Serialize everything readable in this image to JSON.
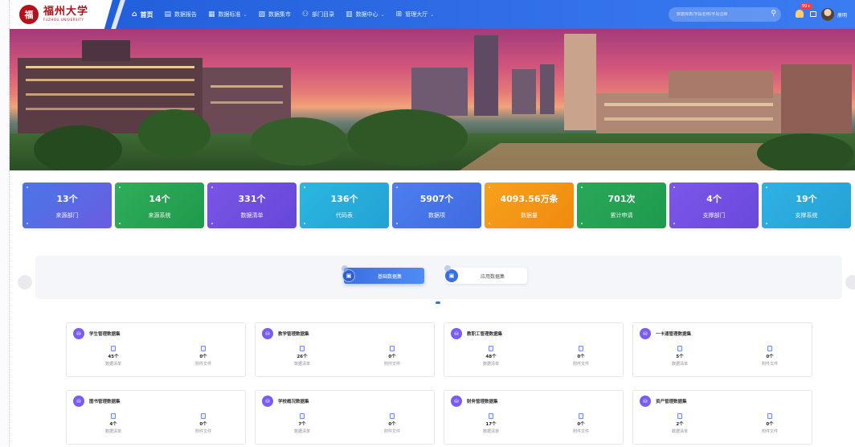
{
  "header": {
    "logo_seal": "福",
    "logo_cn": "福州大学",
    "logo_en": "FUZHOU UNIVERSITY",
    "nav": [
      {
        "label": "首页",
        "icon": "home-icon",
        "active": true,
        "dropdown": false
      },
      {
        "label": "数据报告",
        "icon": "report-icon",
        "active": false,
        "dropdown": false
      },
      {
        "label": "数据标准",
        "icon": "standard-icon",
        "active": false,
        "dropdown": true
      },
      {
        "label": "数据集市",
        "icon": "market-icon",
        "active": false,
        "dropdown": false
      },
      {
        "label": "部门目录",
        "icon": "org-icon",
        "active": false,
        "dropdown": false
      },
      {
        "label": "数据中心",
        "icon": "center-icon",
        "active": false,
        "dropdown": true
      },
      {
        "label": "管理大厅",
        "icon": "grid-icon",
        "active": false,
        "dropdown": true
      }
    ],
    "search_placeholder": "数据库表/字段名称/字段注释",
    "badge": "99+",
    "username": "册明"
  },
  "stats": [
    {
      "value": "13个",
      "label": "来源部门",
      "color": "#4a76e8",
      "color2": "#6a5de0"
    },
    {
      "value": "14个",
      "label": "来源系统",
      "color": "#2fae5a",
      "color2": "#1f9a4c"
    },
    {
      "value": "331个",
      "label": "数据清单",
      "color": "#7a55e6",
      "color2": "#6548d8"
    },
    {
      "value": "136个",
      "label": "代码表",
      "color": "#2bb7e0",
      "color2": "#23a2d4"
    },
    {
      "value": "5907个",
      "label": "数据项",
      "color": "#4d7ef0",
      "color2": "#3f6be0"
    },
    {
      "value": "4093.56万条",
      "label": "数据量",
      "color": "#f7a11c",
      "color2": "#f08a10"
    },
    {
      "value": "701次",
      "label": "累计申请",
      "color": "#2aa85a",
      "color2": "#1e9a4c"
    },
    {
      "value": "4个",
      "label": "支撑部门",
      "color": "#7c58e8",
      "color2": "#6a48dc"
    },
    {
      "value": "19个",
      "label": "支撑系统",
      "color": "#2fb2e3",
      "color2": "#25a0d6"
    }
  ],
  "tabs": {
    "basic": "基础数据集",
    "app": "应用数据集"
  },
  "datasets": [
    {
      "title": "学生管理数据集",
      "list_count": "45个",
      "list_label": "数据清单",
      "doc_count": "0个",
      "doc_label": "附件文件"
    },
    {
      "title": "教学管理数据集",
      "list_count": "26个",
      "list_label": "数据清单",
      "doc_count": "0个",
      "doc_label": "附件文件"
    },
    {
      "title": "教职工管理数据集",
      "list_count": "48个",
      "list_label": "数据清单",
      "doc_count": "0个",
      "doc_label": "附件文件"
    },
    {
      "title": "一卡通管理数据集",
      "list_count": "5个",
      "list_label": "数据清单",
      "doc_count": "0个",
      "doc_label": "附件文件"
    },
    {
      "title": "图书管理数据集",
      "list_count": "4个",
      "list_label": "数据清单",
      "doc_count": "0个",
      "doc_label": "附件文件"
    },
    {
      "title": "学校概况数据集",
      "list_count": "7个",
      "list_label": "数据清单",
      "doc_count": "0个",
      "doc_label": "附件文件"
    },
    {
      "title": "财务管理数据集",
      "list_count": "17个",
      "list_label": "数据清单",
      "doc_count": "0个",
      "doc_label": "附件文件"
    },
    {
      "title": "资产管理数据集",
      "list_count": "2个",
      "list_label": "数据清单",
      "doc_count": "0个",
      "doc_label": "附件文件"
    }
  ]
}
